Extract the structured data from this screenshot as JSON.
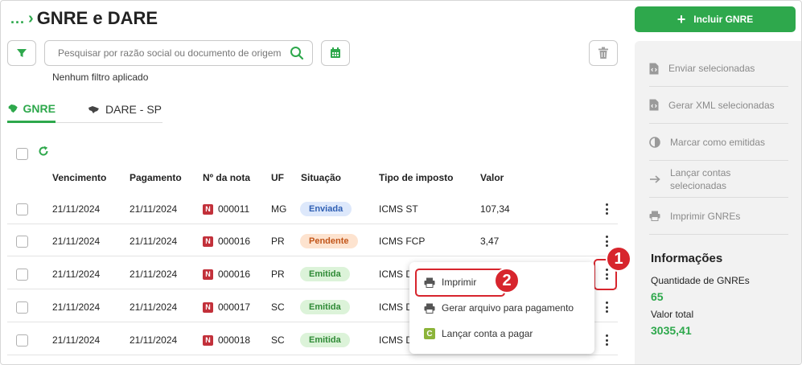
{
  "header": {
    "breadcrumb_dots": "...",
    "title": "GNRE e DARE"
  },
  "search": {
    "placeholder": "Pesquisar por razão social ou documento de origem"
  },
  "filter_status": "Nenhum filtro aplicado",
  "tabs": [
    {
      "label": "GNRE"
    },
    {
      "label": "DARE - SP"
    }
  ],
  "table": {
    "columns": [
      "Vencimento",
      "Pagamento",
      "Nº da nota",
      "UF",
      "Situação",
      "Tipo de imposto",
      "Valor"
    ],
    "rows": [
      {
        "vencimento": "21/11/2024",
        "pagamento": "21/11/2024",
        "nota": "000011",
        "uf": "MG",
        "situacao": "Enviada",
        "tipo": "ICMS ST",
        "valor": "107,34"
      },
      {
        "vencimento": "21/11/2024",
        "pagamento": "21/11/2024",
        "nota": "000016",
        "uf": "PR",
        "situacao": "Pendente",
        "tipo": "ICMS FCP",
        "valor": "3,47"
      },
      {
        "vencimento": "21/11/2024",
        "pagamento": "21/11/2024",
        "nota": "000016",
        "uf": "PR",
        "situacao": "Emitida",
        "tipo": "ICMS D",
        "valor": ""
      },
      {
        "vencimento": "21/11/2024",
        "pagamento": "21/11/2024",
        "nota": "000017",
        "uf": "SC",
        "situacao": "Emitida",
        "tipo": "ICMS D",
        "valor": ""
      },
      {
        "vencimento": "21/11/2024",
        "pagamento": "21/11/2024",
        "nota": "000018",
        "uf": "SC",
        "situacao": "Emitida",
        "tipo": "ICMS D",
        "valor": ""
      }
    ],
    "nota_badge": "N"
  },
  "status_colors": {
    "Enviada": {
      "bg": "#dde8fb",
      "fg": "#2f5fb3"
    },
    "Pendente": {
      "bg": "#fde3cf",
      "fg": "#c2561a"
    },
    "Emitida": {
      "bg": "#dcf3d9",
      "fg": "#2f8a36"
    }
  },
  "context_menu": {
    "items": [
      {
        "label": "Imprimir",
        "icon": "printer-icon"
      },
      {
        "label": "Gerar arquivo para pagamento",
        "icon": "printer-icon"
      },
      {
        "label": "Lançar conta a pagar",
        "icon": "c-badge-icon",
        "badge": "C"
      }
    ]
  },
  "markers": [
    "1",
    "2"
  ],
  "actions": {
    "add_label": "Incluir GNRE"
  },
  "sidebar": {
    "items": [
      {
        "label": "Enviar selecionadas",
        "icon": "file-code-icon"
      },
      {
        "label": "Gerar XML selecionadas",
        "icon": "file-code-icon"
      },
      {
        "label": "Marcar como emitidas",
        "icon": "half-circle-icon"
      },
      {
        "label": "Lançar contas selecionadas",
        "icon": "arrow-right-icon"
      },
      {
        "label": "Imprimir GNREs",
        "icon": "printer-icon"
      }
    ],
    "info": {
      "title": "Informações",
      "count_label": "Quantidade de GNREs",
      "count_value": "65",
      "total_label": "Valor total",
      "total_value": "3035,41"
    }
  },
  "colors": {
    "accent": "#2ea84c",
    "highlight": "#d7252d",
    "nota_badge": "#c2303a"
  }
}
